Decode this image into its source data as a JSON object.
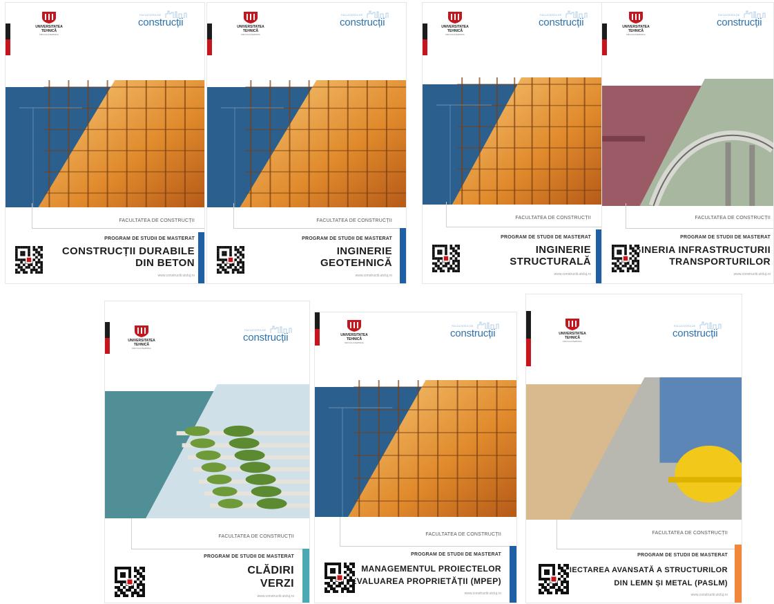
{
  "common": {
    "university": "UNIVERSITATEA TEHNICĂ",
    "university_sub": "DIN CLUJ-NAPOCA",
    "brand_tag": "FACULTATEA DE",
    "brand_word": "construcții",
    "faculty": "FACULTATEA DE CONSTRUCȚII",
    "program_label": "PROGRAM DE STUDII DE MASTERAT",
    "website": "www.constructii.utcluj.ro"
  },
  "brochures": [
    {
      "title_line1": "CONSTRUCȚII DURABILE",
      "title_line2": "DIN BETON",
      "accent": "#1f5fa3",
      "theme": "scaffold"
    },
    {
      "title_line1": "INGINERIE",
      "title_line2": "GEOTEHNICĂ",
      "accent": "#1f5fa3",
      "theme": "scaffold"
    },
    {
      "title_line1": "INGINERIE",
      "title_line2": "STRUCTURALĂ",
      "accent": "#1f5fa3",
      "theme": "scaffold"
    },
    {
      "title_line1": "INGINERIA INFRASTRUCTURII",
      "title_line2": "TRANSPORTURILOR",
      "accent": "#1f5fa3",
      "theme": "bridge"
    },
    {
      "title_line1": "CLĂDIRI",
      "title_line2": "VERZI",
      "accent": "#4aa9b2",
      "theme": "green"
    },
    {
      "title_line1": "MANAGEMENTUL PROIECTELOR",
      "title_line2": "ȘI EVALUAREA PROPRIETĂȚII (MPEP)",
      "accent": "#1f5fa3",
      "theme": "scaffold"
    },
    {
      "title_line1": "PROIECTAREA AVANSATĂ A STRUCTURILOR",
      "title_line2": "DIN LEMN ȘI METAL (PASLM)",
      "accent": "#f0873a",
      "theme": "helmet"
    }
  ]
}
